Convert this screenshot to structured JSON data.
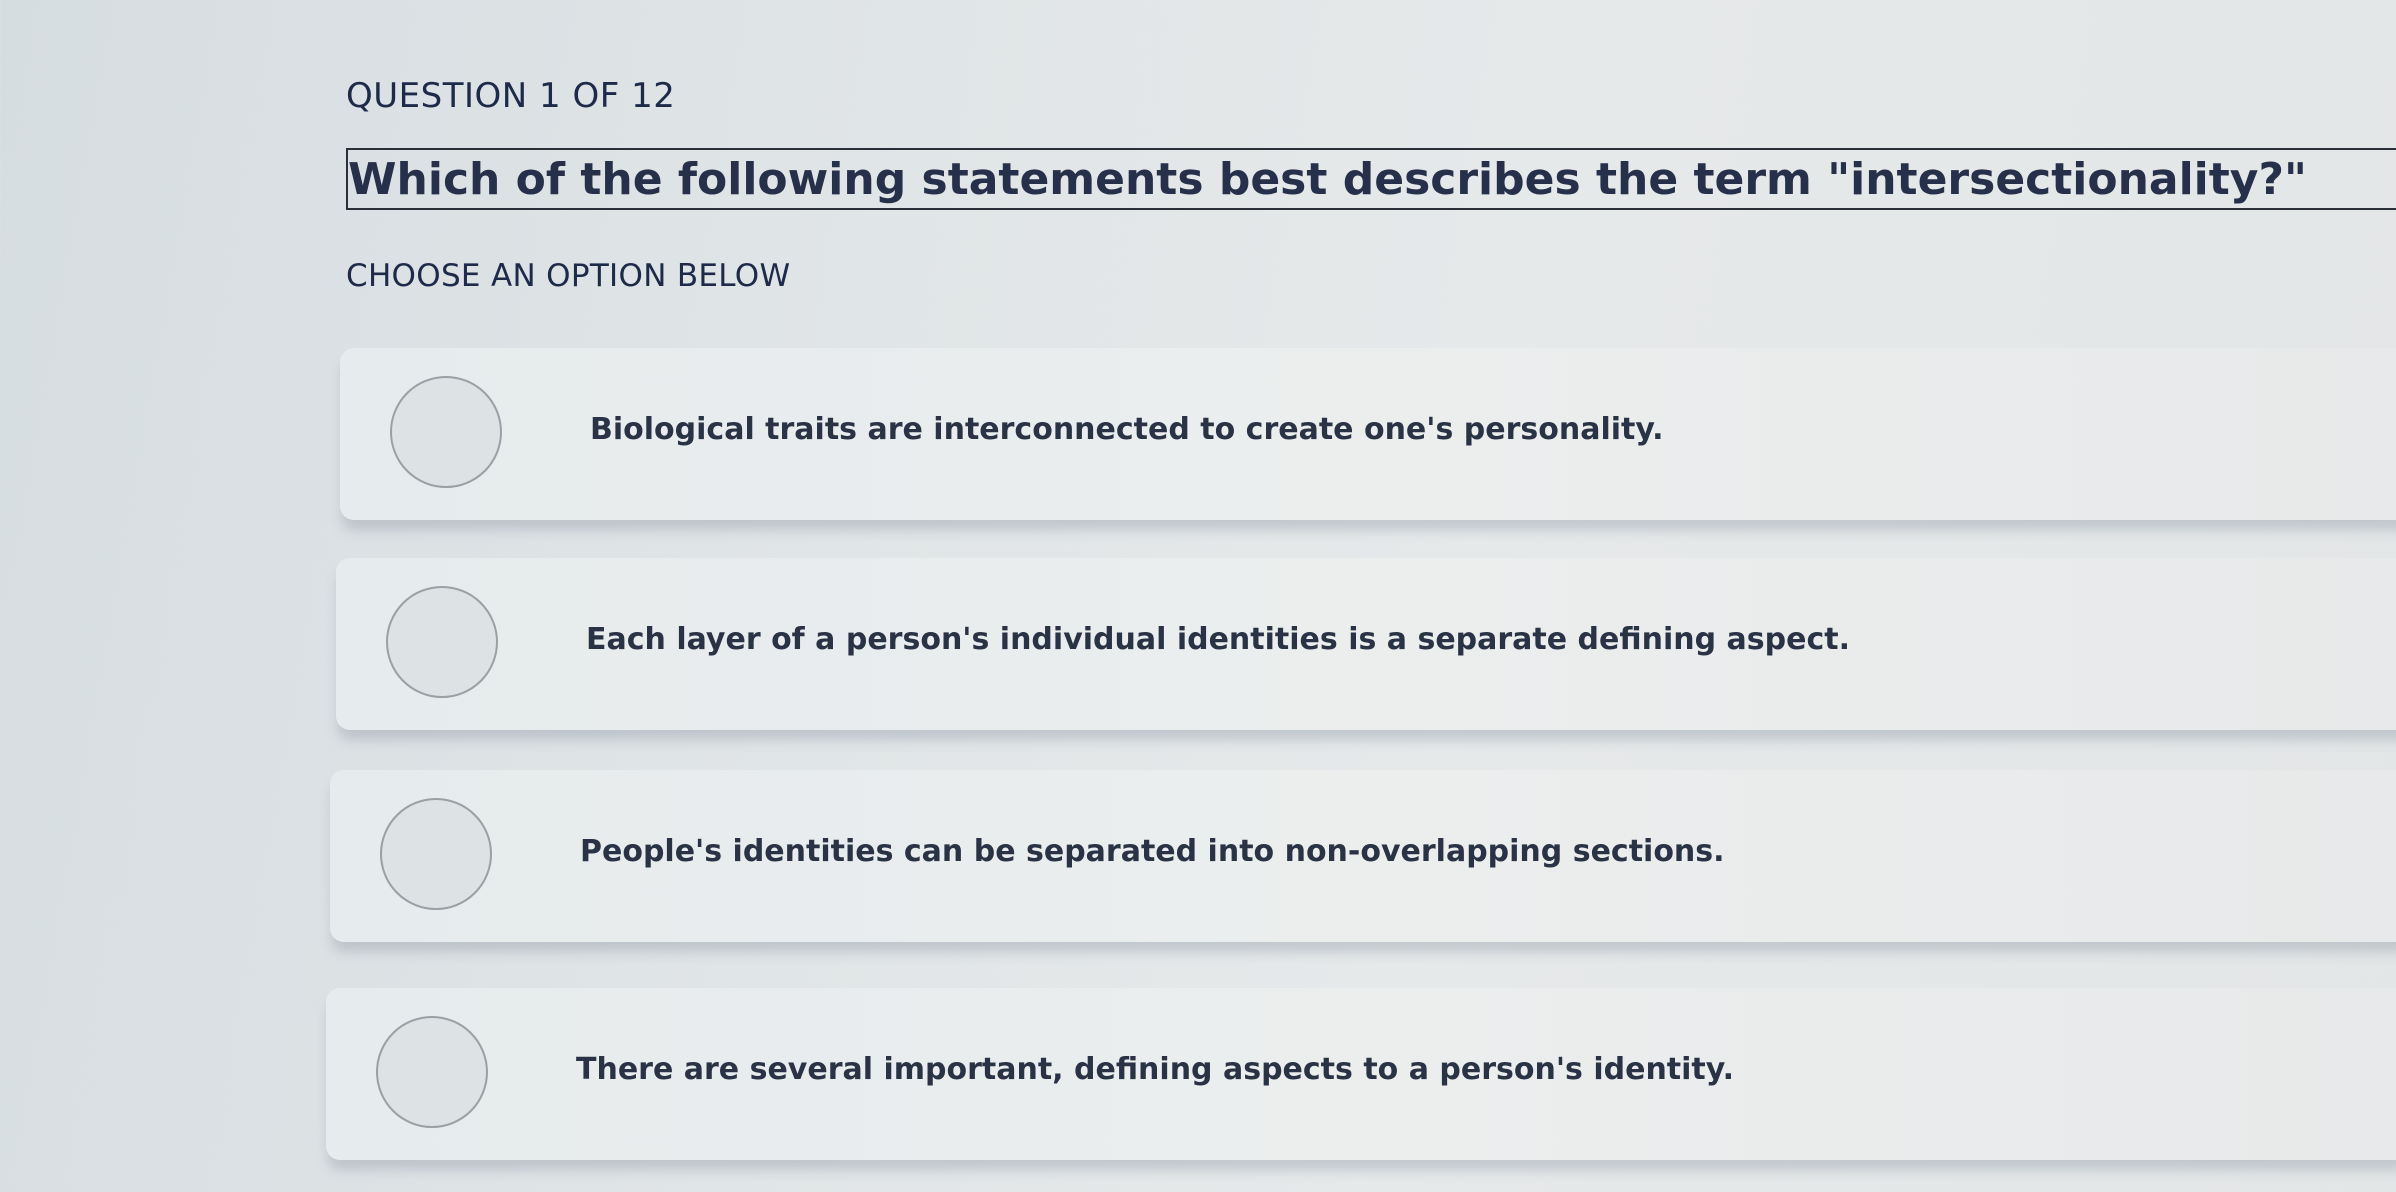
{
  "quiz": {
    "counter": "QUESTION 1 OF 12",
    "question": "Which of the following statements best describes the term \"intersectionality?\"",
    "instruction": "CHOOSE AN OPTION BELOW",
    "options": [
      {
        "label": "Biological traits are interconnected to create one's personality."
      },
      {
        "label": "Each layer of a person's individual identities is a separate defining aspect."
      },
      {
        "label": "People's identities can be separated into non-overlapping sections."
      },
      {
        "label": "There are several important, defining aspects to a person's identity."
      }
    ]
  }
}
